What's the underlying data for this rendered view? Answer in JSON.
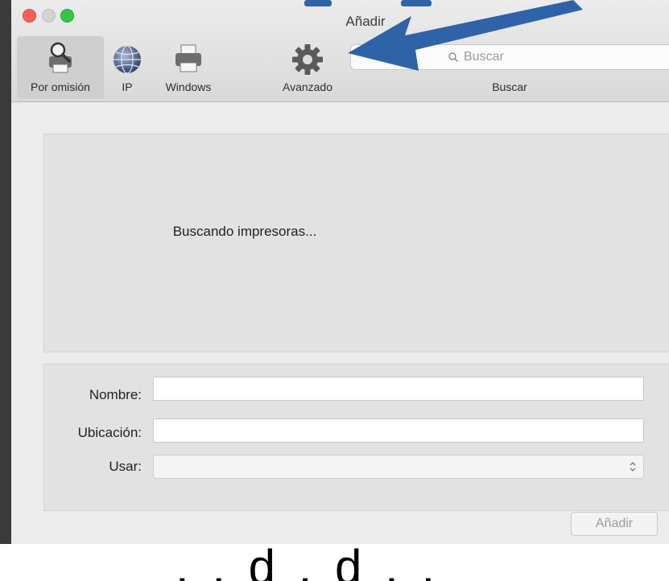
{
  "window": {
    "title": "Añadir"
  },
  "toolbar": {
    "items": [
      {
        "label": "Por omisión",
        "icon": "default-printer-icon",
        "selected": true
      },
      {
        "label": "IP",
        "icon": "globe-icon",
        "selected": false
      },
      {
        "label": "Windows",
        "icon": "printer-icon",
        "selected": false
      },
      {
        "label": "Avanzado",
        "icon": "gear-icon",
        "selected": false
      }
    ],
    "search": {
      "placeholder": "Buscar",
      "label": "Buscar"
    }
  },
  "list": {
    "status": "Buscando impresoras..."
  },
  "form": {
    "name_label": "Nombre:",
    "name_value": "",
    "location_label": "Ubicación:",
    "location_value": "",
    "use_label": "Usar:",
    "use_value": ""
  },
  "actions": {
    "add_label": "Añadir"
  },
  "overlay": {
    "bottom_text": "...do de a ...rso... ...tim ...//...",
    "arrow_color": "#2f63a7"
  },
  "colors": {
    "accent": "#2f63a7",
    "close": "#fc5f57",
    "zoom": "#33c748"
  }
}
